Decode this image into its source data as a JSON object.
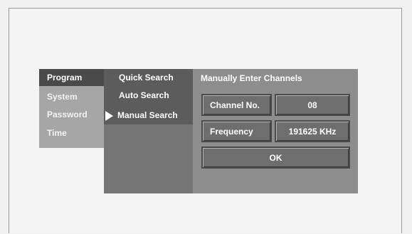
{
  "menu": {
    "categories": [
      "Program",
      "System",
      "Password",
      "Time"
    ],
    "submenu": [
      "Quick Search",
      "Auto Search",
      "Manual Search"
    ],
    "panel_title": "Manually Enter Channels",
    "fields": [
      {
        "label": "Channel No.",
        "value": "08"
      },
      {
        "label": "Frequency",
        "value": "191625 KHz"
      }
    ],
    "ok_label": "OK"
  },
  "icons": {
    "selection_indicator": "play-arrow-icon"
  },
  "colors": {
    "page_bg": "#f1f1f1",
    "left_column": "#a6a6a6",
    "left_selected": "#4a4a4a",
    "middle_column": "#757575",
    "middle_top": "#5c5c5c",
    "right_panel": "#8d8d8d",
    "cell_bg": "#6e6e6e",
    "text": "#ffffff"
  }
}
